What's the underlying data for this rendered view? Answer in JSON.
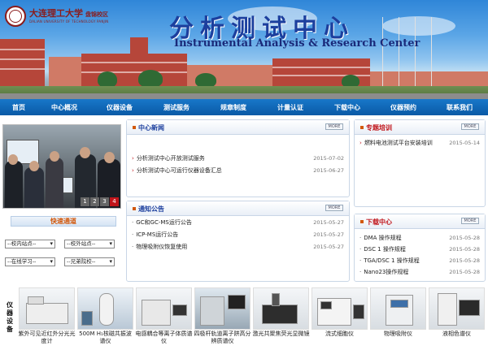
{
  "header": {
    "logo_cn": "大连理工大学",
    "logo_campus": "盘锦校区",
    "logo_en": "DALIAN UNIVERSITY OF TECHNOLOGY PANJIN",
    "title_cn": "分析测试中心",
    "title_en": "Instrumental Analysis & Research Center"
  },
  "nav": {
    "items": [
      "首页",
      "中心概况",
      "仪器设备",
      "测试服务",
      "规章制度",
      "计量认证",
      "下载中心",
      "仪器预约",
      "联系我们"
    ]
  },
  "slider": {
    "pages": [
      "1",
      "2",
      "3",
      "4"
    ],
    "active_page": "4"
  },
  "quick_nav": {
    "title": "快速通道",
    "selects": [
      "--校内站点--",
      "--校外站点--",
      "--在线学习--",
      "--兄弟院校--"
    ]
  },
  "center_news": {
    "title": "中心新闻",
    "more": "MORE",
    "items": [
      {
        "title": "分析测试中心开放测试服务",
        "date": "2015-07-02"
      },
      {
        "title": "分析测试中心可运行仪器设备汇总",
        "date": "2015-06-27"
      }
    ]
  },
  "notices": {
    "title": "通知公告",
    "more": "MORE",
    "items": [
      {
        "title": "GC和GC-MS运行公告",
        "date": "2015-05-27"
      },
      {
        "title": "ICP-MS运行公告",
        "date": "2015-05-27"
      },
      {
        "title": "物理吸附仪恢复使用",
        "date": "2015-05-27"
      }
    ]
  },
  "training": {
    "title": "专题培训",
    "more": "MORE",
    "items": [
      {
        "title": "燃料电池测试平台安装培训",
        "date": "2015-05-14"
      }
    ]
  },
  "downloads": {
    "title": "下载中心",
    "more": "MORE",
    "items": [
      {
        "title": "DMA 操作规程",
        "date": "2015-05-28"
      },
      {
        "title": "DSC 1 操作规程",
        "date": "2015-05-28"
      },
      {
        "title": "TGA/DSC 1 操作规程",
        "date": "2015-05-28"
      },
      {
        "title": "Nano23操作规程",
        "date": "2015-05-28"
      }
    ]
  },
  "equipment": {
    "label": [
      "仪",
      "器",
      "设",
      "备"
    ],
    "items": [
      "紫外可见近红外分光光度计",
      "500M H₁核磁共振波谱仪",
      "电感耦合等离子体质谱仪",
      "四极杆轨道离子阱高分辨质谱仪",
      "激光共聚焦荧光显微镜",
      "流式细胞仪",
      "物理吸附仪",
      "液相色谱仪"
    ]
  },
  "colors": {
    "nav_bg": "#0a5aa6",
    "title_blue": "#1c3f9e",
    "accent_orange": "#d2580c",
    "accent_red": "#c0141a"
  }
}
